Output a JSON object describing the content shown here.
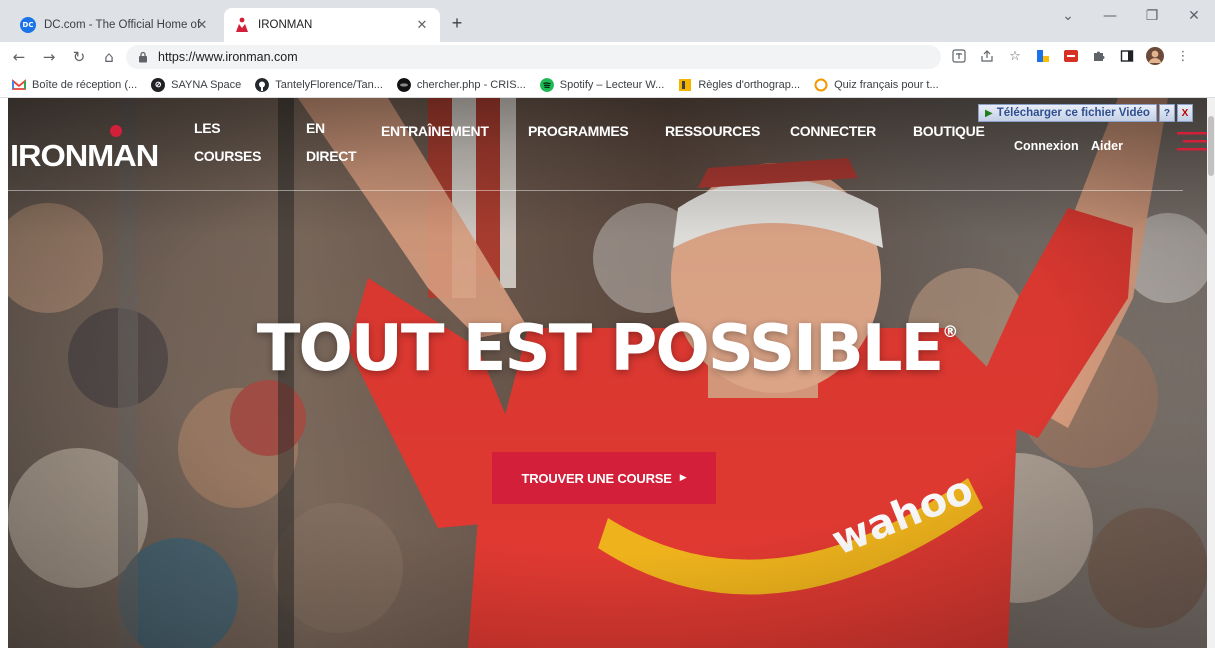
{
  "browser": {
    "tabs": [
      {
        "title": "DC.com - The Official Home of DC",
        "active": false,
        "close": "✕"
      },
      {
        "title": "IRONMAN",
        "active": true,
        "close": "✕"
      }
    ],
    "new_tab": "+",
    "url": "https://www.ironman.com",
    "bookmarks": [
      {
        "label": "Boîte de réception (...",
        "icon": "gmail-icon",
        "color": "#ea4335"
      },
      {
        "label": "SAYNA Space",
        "icon": "sayna-icon",
        "color": "#202124"
      },
      {
        "label": "TantelyFlorence/Tan...",
        "icon": "github-icon",
        "color": "#24292e"
      },
      {
        "label": "chercher.php - CRIS...",
        "icon": "cris-icon",
        "color": "#111111"
      },
      {
        "label": "Spotify – Lecteur W...",
        "icon": "spotify-icon",
        "color": "#1db954"
      },
      {
        "label": "Règles d'orthograp...",
        "icon": "book-icon",
        "color": "#f4b400"
      },
      {
        "label": "Quiz français pour t...",
        "icon": "quiz-icon",
        "color": "#f29900"
      }
    ]
  },
  "site": {
    "logo": "IRONMAN",
    "nav": {
      "courses_line1": "LES",
      "courses_line2": "COURSES",
      "direct_line1": "EN",
      "direct_line2": "DIRECT",
      "entrainement": "ENTRAÎNEMENT",
      "programmes": "PROGRAMMES",
      "ressources": "RESSOURCES",
      "connecter": "CONNECTER",
      "boutique": "BOUTIQUE",
      "connexion": "Connexion",
      "aider": "Aider"
    },
    "download_widget": {
      "label": "Télécharger ce fichier Vidéo",
      "help": "?",
      "close": "X"
    },
    "hero": {
      "headline": "TOUT EST POSSIBLE",
      "registered": "®",
      "cta": "TROUVER UNE COURSE",
      "cta_arrow": "▶"
    }
  },
  "colors": {
    "brand_red": "#d41f3a",
    "jersey_red": "#e23a32",
    "jersey_yellow": "#f1b51c"
  }
}
